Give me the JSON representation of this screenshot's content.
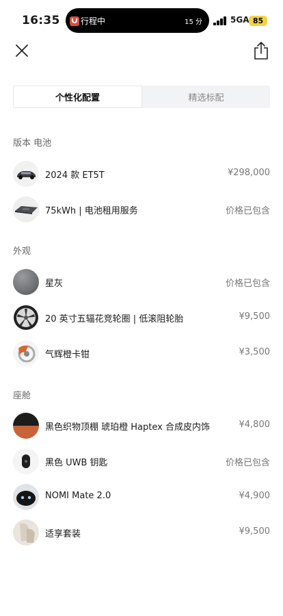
{
  "status": {
    "time": "16:35",
    "island_title": "行程中",
    "island_right": "15 分",
    "network": "5GA",
    "battery": "85"
  },
  "nav": {
    "close_icon": "close-icon",
    "share_icon": "share-icon"
  },
  "tabs": [
    {
      "label": "个性化配置",
      "active": true
    },
    {
      "label": "精选标配",
      "active": false
    }
  ],
  "sections": [
    {
      "title": "版本 电池",
      "items": [
        {
          "label": "2024 款 ET5T",
          "price": "¥298,000",
          "icon": "car-thumbnail"
        },
        {
          "label": "75kWh | 电池租用服务",
          "price": "价格已包含",
          "icon": "battery-pack-thumbnail"
        }
      ]
    },
    {
      "title": "外观",
      "items": [
        {
          "label": "星灰",
          "price": "价格已包含",
          "icon": "paint-swatch-gray"
        },
        {
          "label": "20 英寸五辐花竞轮圈 | 低滚阻轮胎",
          "price": "¥9,500",
          "icon": "wheel-thumbnail"
        },
        {
          "label": "气辉橙卡钳",
          "price": "¥3,500",
          "icon": "caliper-thumbnail"
        }
      ]
    },
    {
      "title": "座舱",
      "items": [
        {
          "label": "黑色织物顶棚 琥珀橙 Haptex 合成皮内饰",
          "price": "¥4,800",
          "icon": "interior-swatch"
        },
        {
          "label": "黑色 UWB 钥匙",
          "price": "价格已包含",
          "icon": "key-thumbnail"
        },
        {
          "label": "NOMI Mate 2.0",
          "price": "¥4,900",
          "icon": "nomi-thumbnail"
        },
        {
          "label": "适享套装",
          "price": "¥9,500",
          "icon": "seat-package-thumbnail"
        }
      ]
    }
  ],
  "colors": {
    "star_gray": "#77787b",
    "amber_orange": "#c8643a",
    "battery_badge": "#f4d33e",
    "tab_bg": "#f2f3f5"
  }
}
